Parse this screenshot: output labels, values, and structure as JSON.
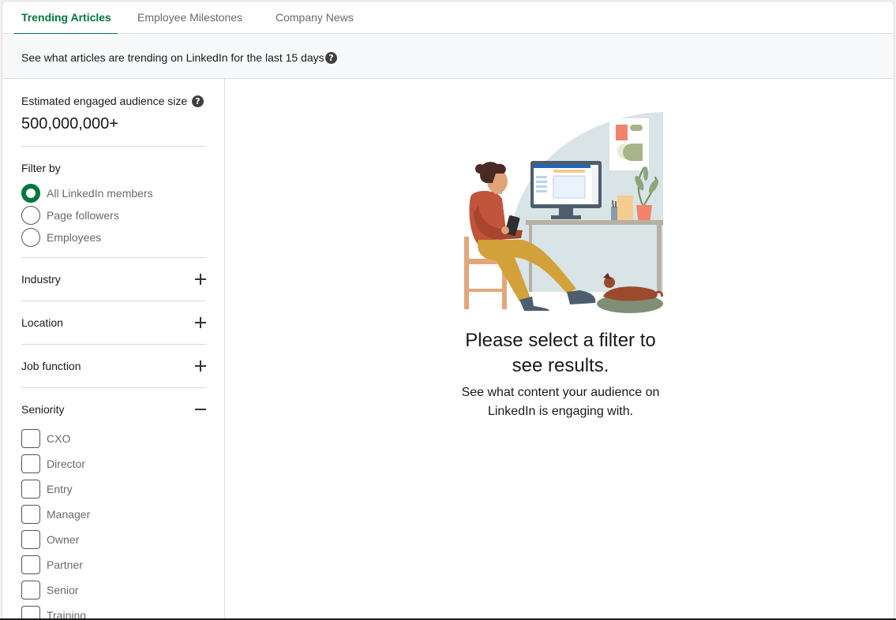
{
  "tabs": [
    {
      "label": "Trending Articles",
      "active": true
    },
    {
      "label": "Employee Milestones",
      "active": false
    },
    {
      "label": "Company News",
      "active": false
    }
  ],
  "info": {
    "text": "See what articles are trending on LinkedIn for the last 15 days",
    "help_icon": "question-circle-icon"
  },
  "audience": {
    "label": "Estimated engaged audience size",
    "value": "500,000,000+"
  },
  "filter": {
    "title": "Filter by",
    "options": [
      {
        "label": "All LinkedIn members",
        "selected": true
      },
      {
        "label": "Page followers",
        "selected": false
      },
      {
        "label": "Employees",
        "selected": false
      }
    ]
  },
  "sections": [
    {
      "label": "Industry",
      "expanded": false
    },
    {
      "label": "Location",
      "expanded": false
    },
    {
      "label": "Job function",
      "expanded": false
    },
    {
      "label": "Seniority",
      "expanded": true
    }
  ],
  "seniority": {
    "items": [
      {
        "label": "CXO",
        "checked": false
      },
      {
        "label": "Director",
        "checked": false
      },
      {
        "label": "Entry",
        "checked": false
      },
      {
        "label": "Manager",
        "checked": false
      },
      {
        "label": "Owner",
        "checked": false
      },
      {
        "label": "Partner",
        "checked": false
      },
      {
        "label": "Senior",
        "checked": false
      },
      {
        "label": "Training",
        "checked": false
      }
    ]
  },
  "empty_state": {
    "title_line1": "Please select a filter to",
    "title_line2": "see results.",
    "subtitle_line1": "See what content your audience on",
    "subtitle_line2": "LinkedIn is engaging with."
  },
  "colors": {
    "accent": "#057642",
    "info_background": "#f8f9fa"
  }
}
